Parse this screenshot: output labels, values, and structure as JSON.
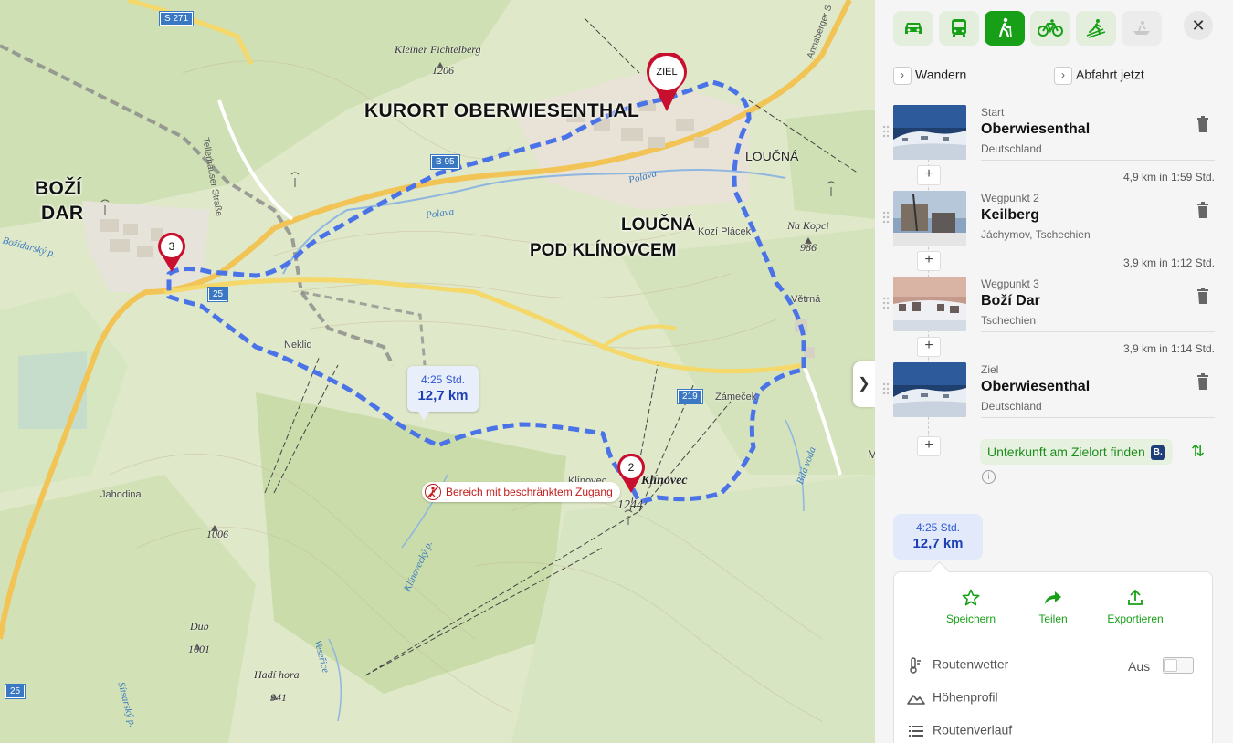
{
  "map": {
    "labels": {
      "kurort": "KURORT OBERWIESENTHAL",
      "bozi_line1": "BOŽÍ",
      "bozi_line2": "DAR",
      "loucna_pod_line1": "LOUČNÁ",
      "loucna_pod_line2": "POD KLÍNOVCEM",
      "loucna": "LOUČNÁ",
      "kleiner_fichtelberg": "Kleiner Fichtelberg",
      "kleiner_fichtelberg_elev": "1206",
      "na_kopci": "Na Kopci",
      "na_kopci_elev": "986",
      "kozi_placek": "Kozí Plácek",
      "vetrna": "Větrná",
      "zamecek": "Zámeček",
      "neklid": "Neklid",
      "jahodina": "Jahodina",
      "elev_1006": "1006",
      "dub": "Dub",
      "dub_elev": "1001",
      "hadi_hora": "Hadí hora",
      "hadi_hora_elev": "941",
      "klinovec": "Klínovec",
      "klinovec_big": "Klínovec",
      "klinovec_elev": "1244",
      "tellerhauser": "Tellerhäuser Straße",
      "annaberger": "Annaberger S",
      "polava1": "Polava",
      "polava2": "Polava",
      "bozidarsky": "Božídarský p.",
      "klinovecky": "Klínovecký p.",
      "vejprtsky": "Veseřice",
      "bila_voda": "Bílá voda",
      "stitaresky": "Sítsarský p.",
      "m_edge": "M"
    },
    "shields": {
      "s271": "S 271",
      "b95": "B 95",
      "r25": "25",
      "r219": "219",
      "r25b": "25"
    },
    "pins": {
      "ziel": "ZIEL",
      "wp3": "3",
      "wp2": "2"
    },
    "route_callout": {
      "time": "4:25 Std.",
      "distance": "12,7 km"
    },
    "restricted_label": "Bereich mit beschränktem Zugang",
    "route_color": "#4a73e8"
  },
  "panel": {
    "modes": [
      {
        "name": "car-icon",
        "active": false
      },
      {
        "name": "bus-icon",
        "active": false
      },
      {
        "name": "hiking-icon",
        "active": true
      },
      {
        "name": "bike-icon",
        "active": false
      },
      {
        "name": "ski-touring-icon",
        "active": false
      },
      {
        "name": "boat-icon",
        "active": false
      }
    ],
    "activity": "Wandern",
    "departure": "Abfahrt jetzt",
    "waypoints": [
      {
        "kind": "Start",
        "name": "Oberwiesenthal",
        "country": "Deutschland"
      },
      {
        "kind": "Wegpunkt 2",
        "name": "Keilberg",
        "country": "Jáchymov, Tschechien"
      },
      {
        "kind": "Wegpunkt 3",
        "name": "Boží Dar",
        "country": "Tschechien"
      },
      {
        "kind": "Ziel",
        "name": "Oberwiesenthal",
        "country": "Deutschland"
      }
    ],
    "segments": [
      "4,9 km in 1:59 Std.",
      "3,9 km in 1:12 Std.",
      "3,9 km in 1:14 Std."
    ],
    "plus_label": "+",
    "accommodation": "Unterkunft am Zielort finden",
    "booking_badge": "B.",
    "info_label": "i",
    "summary": {
      "time": "4:25 Std.",
      "distance": "12,7 km"
    },
    "actions": {
      "save": "Speichern",
      "share": "Teilen",
      "export": "Exportieren"
    },
    "rows": {
      "weather": "Routenwetter",
      "weather_state": "Aus",
      "profile": "Höhenprofil",
      "course": "Routenverlauf"
    },
    "accent": "#17a017"
  }
}
